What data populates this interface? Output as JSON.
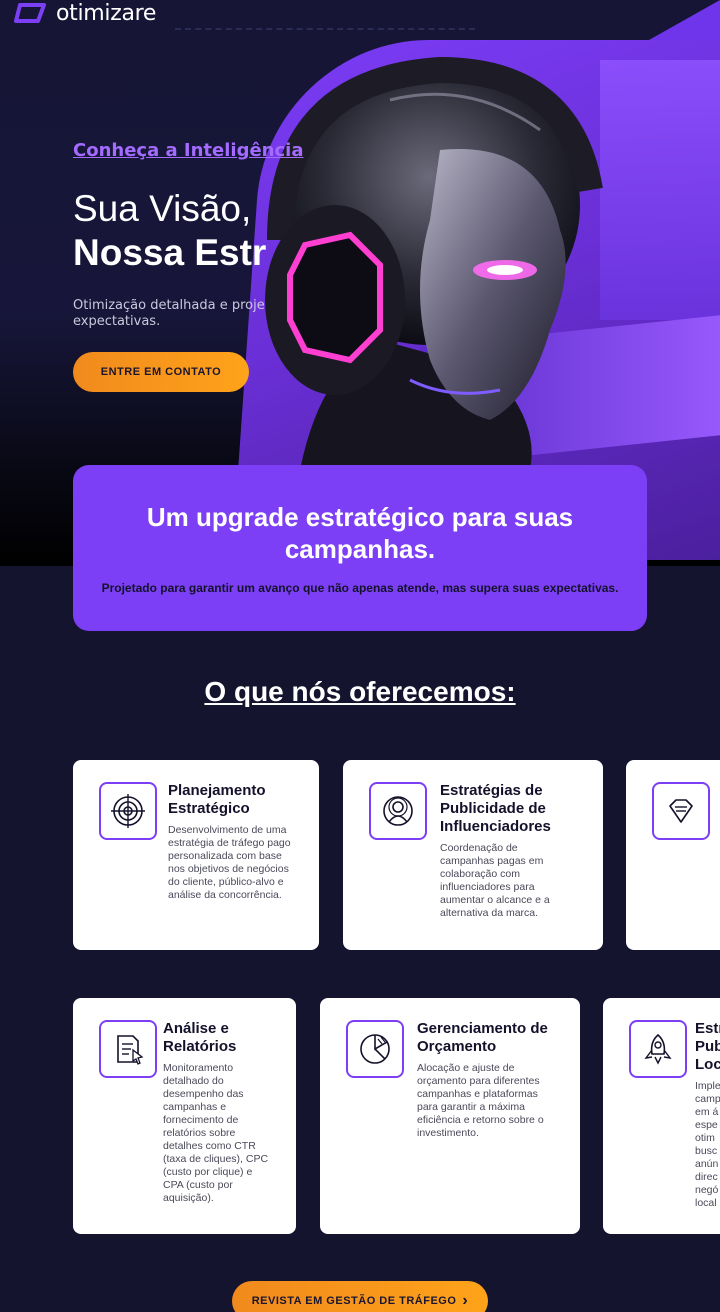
{
  "brand": {
    "name": "otimizare"
  },
  "hero": {
    "eyebrow": "Conheça a Inteligência",
    "title_line1": "Sua Visão,",
    "title_line2": "Nossa Estr",
    "subtitle": "Otimização detalhada e proje expectativas.",
    "cta_label": "ENTRE EM CONTATO"
  },
  "upgrade": {
    "title": "Um upgrade estratégico para suas campanhas.",
    "text": "Projetado para garantir um avanço que não apenas atende, mas supera suas expectativas."
  },
  "services": {
    "title": "O que nós oferecemos:",
    "row1": [
      {
        "title": "Planejamento Estratégico",
        "icon": "target-icon",
        "desc": "Desenvolvimento de uma estratégia de tráfego pago personalizada com base nos objetivos de negócios do cliente, público-alvo e análise da concorrência."
      },
      {
        "title": "Estratégias de Publicidade de Influenciadores",
        "icon": "influencer-icon",
        "desc": "Coordenação de campanhas pagas em colaboração com influenciadores para aumentar o alcance e a alternativa da marca."
      },
      {
        "title": "",
        "icon": "diamond-icon",
        "desc": ""
      }
    ],
    "row2": [
      {
        "title": "Análise e Relatórios",
        "icon": "report-icon",
        "desc": "Monitoramento detalhado do desempenho das campanhas e fornecimento de relatórios sobre detalhes como CTR (taxa de cliques), CPC (custo por clique) e CPA (custo por aquisição)."
      },
      {
        "title": "Gerenciamento de Orçamento",
        "icon": "pie-chart-icon",
        "desc": "Alocação e ajuste de orçamento para diferentes campanhas e plataformas para garantir a máxima eficiência e retorno sobre o investimento."
      },
      {
        "title": "Estr Pub Loc",
        "icon": "rocket-icon",
        "desc": "Imple camp em á espe otim busc anún direc negó local"
      }
    ]
  },
  "bottom_cta": {
    "label": "REVISTA EM GESTÃO DE TRÁFEGO",
    "chevron": "›"
  },
  "colors": {
    "accent": "#7c3ff5",
    "cta": "#ffa31a",
    "background": "#14142e"
  }
}
